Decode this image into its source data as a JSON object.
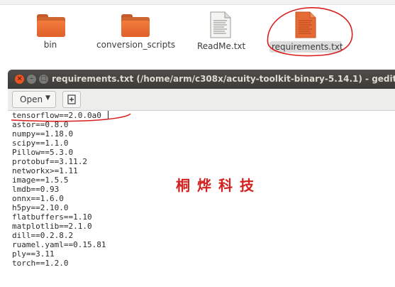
{
  "file_manager": {
    "items": [
      {
        "label": "bin",
        "icon": "folder-icon"
      },
      {
        "label": "conversion_scripts",
        "icon": "folder-icon"
      },
      {
        "label": "ReadMe.txt",
        "icon": "text-file-icon"
      },
      {
        "label": "requirements.txt",
        "icon": "text-file-icon",
        "selected": true
      }
    ]
  },
  "window": {
    "title": "requirements.txt (/home/arm/c308x/acuity-toolkit-binary-5.14.1) - gedit",
    "buttons": {
      "close": "×",
      "minimize": "–",
      "maximize": "□"
    }
  },
  "toolbar": {
    "open_label": "Open",
    "open_arrow": "▼"
  },
  "editor": {
    "lines": [
      "tensorflow==2.0.0a0",
      "astor==0.8.0",
      "numpy==1.18.0",
      "scipy==1.1.0",
      "Pillow==5.3.0",
      "protobuf==3.11.2",
      "networkx>=1.11",
      "image==1.5.5",
      "lmdb==0.93",
      "onnx==1.6.0",
      "h5py==2.10.0",
      "flatbuffers==1.10",
      "matplotlib==2.1.0",
      "dill==0.2.8.2",
      "ruamel.yaml==0.15.81",
      "ply==3.11",
      "torch==1.2.0"
    ]
  },
  "watermark": {
    "text": "桐烨科技"
  },
  "colors": {
    "accent": "#e95420",
    "annotation": "#d81e1e",
    "titlebar": "#3c3b37"
  }
}
